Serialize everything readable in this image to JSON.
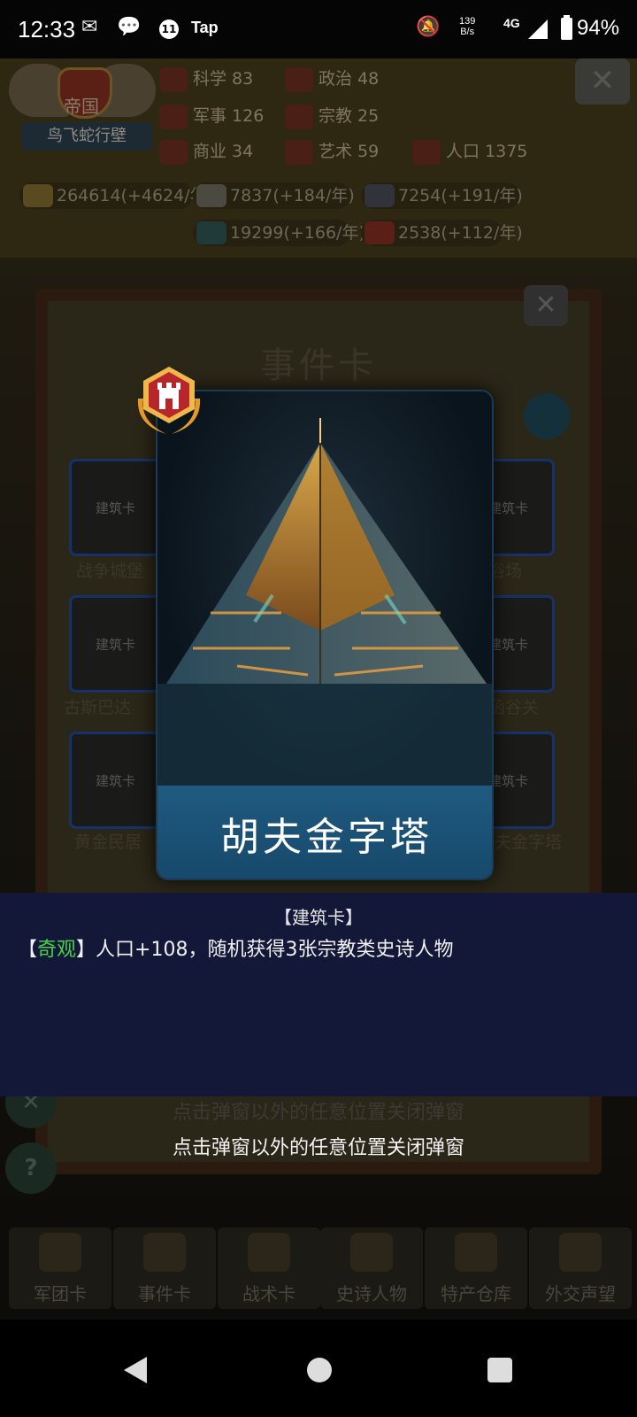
{
  "status_bar": {
    "time": "12:33",
    "app_label": "Tap",
    "notification_count": "11",
    "net_speed_value": "139",
    "net_speed_unit": "B/s",
    "network_type": "4G",
    "battery": "94%"
  },
  "empire": {
    "title": "帝国",
    "name": "鸟飞蛇行壁"
  },
  "stats": {
    "science": "科学 83",
    "politics": "政治 48",
    "military": "军事 126",
    "religion": "宗教 25",
    "commerce": "商业 34",
    "art": "艺术 59",
    "population": "人口 1375"
  },
  "resources": {
    "gold": "264614(+4624/年)",
    "stone": "7837(+184/年)",
    "iron": "7254(+191/年)",
    "wood": "19299(+166/年)",
    "food": "2538(+112/年)"
  },
  "panel": {
    "title": "事件卡",
    "card_tag": "建筑卡",
    "cards": [
      "战争城堡",
      "浴场",
      "古斯巴达",
      "函谷关",
      "黄金民居",
      "胡夫金字塔"
    ]
  },
  "card": {
    "name": "胡夫金字塔"
  },
  "description": {
    "type": "【建筑卡】",
    "bracket_open": "【",
    "category": "奇观",
    "effect": "】人口+108，随机获得3张宗教类史诗人物"
  },
  "hint": "点击弹窗以外的任意位置关闭弹窗",
  "bottom_nav": {
    "items": [
      "军团卡",
      "事件卡",
      "战术卡",
      "史诗人物",
      "特产仓库",
      "外交声望"
    ]
  },
  "colors": {
    "category_highlight": "#46d04a",
    "card_name_bar": "#1f5a80",
    "description_bg": "#131838"
  }
}
